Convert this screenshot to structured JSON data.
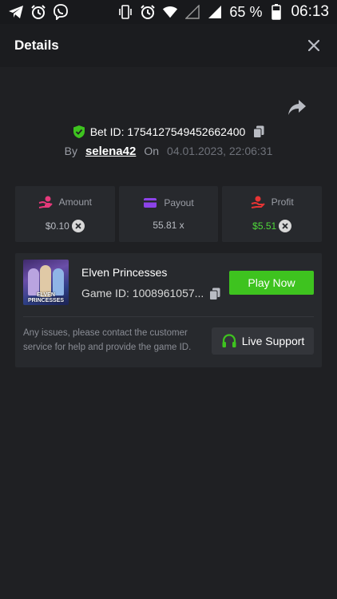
{
  "status_bar": {
    "left_icons": [
      "telegram-icon",
      "alarm-icon",
      "viber-icon"
    ],
    "right_icons": [
      "vibrate-icon",
      "alarm-icon",
      "wifi-icon",
      "signal-empty-icon",
      "signal-icon",
      "battery-icon"
    ],
    "battery": "65 %",
    "time": "06:13"
  },
  "header": {
    "title": "Details",
    "close_icon": "close-icon"
  },
  "bet": {
    "label": "Bet ID: 1754127549452662400",
    "by_label": "By",
    "user": "selena42",
    "on_label": "On",
    "date": "04.01.2023, 22:06:31"
  },
  "stats": [
    {
      "label": "Amount",
      "value": "$0.10",
      "icon": "hand-coins-icon",
      "icon_color": "#e6397b",
      "currency_icon": true
    },
    {
      "label": "Payout",
      "value": "55.81 x",
      "icon": "card-icon",
      "icon_color": "#8c43e8",
      "currency_icon": false
    },
    {
      "label": "Profit",
      "value": "$5.51",
      "icon": "hand-profit-icon",
      "icon_color": "#e73434",
      "currency_icon": true
    }
  ],
  "game": {
    "name": "Elven Princesses",
    "id": "Game ID: 1008961057...",
    "thumb_label": "ELVEN PRINCESSES",
    "play_label": "Play Now",
    "issues_text": "Any issues, please contact the customer service for help and provide the game ID.",
    "support_label": "Live Support"
  },
  "colors": {
    "accent_green": "#3ec31f",
    "profit_green": "#4fd93a",
    "bg": "#1f2023",
    "card": "#27292d"
  }
}
